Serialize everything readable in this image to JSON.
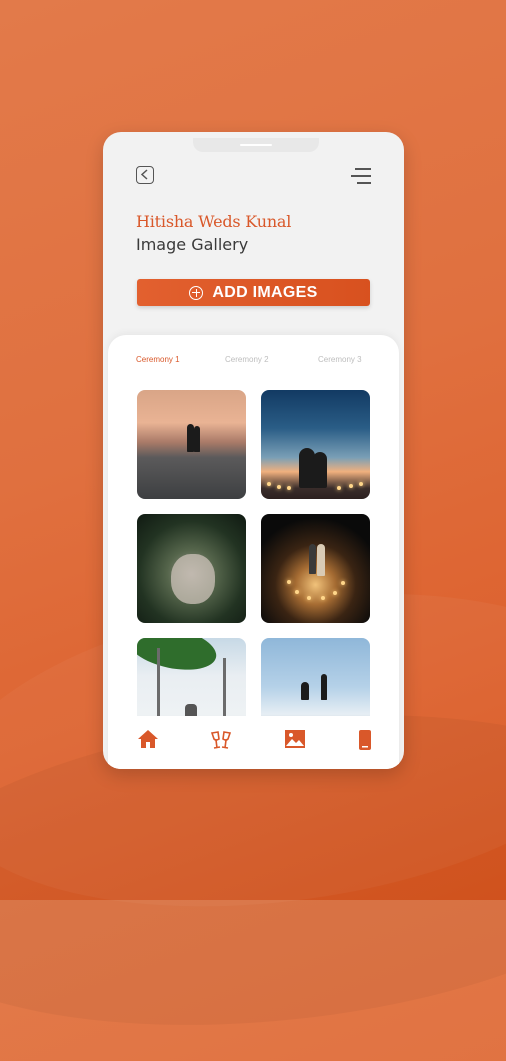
{
  "header": {
    "title_script": "Hitisha Weds Kunal",
    "title_main": "Image Gallery",
    "back_icon": "back-arrow-icon",
    "menu_icon": "hamburger-menu-icon"
  },
  "actions": {
    "add_images_label": "ADD IMAGES",
    "add_icon": "plus-circle-icon"
  },
  "tabs": [
    {
      "label": "Ceremony 1",
      "active": true
    },
    {
      "label": "Ceremony 2",
      "active": false
    },
    {
      "label": "Ceremony 3",
      "active": false
    }
  ],
  "bottom_nav": [
    {
      "icon": "home-icon"
    },
    {
      "icon": "cheers-glasses-icon"
    },
    {
      "icon": "image-gallery-icon"
    },
    {
      "icon": "mobile-phone-icon"
    }
  ],
  "colors": {
    "accent": "#d9582a",
    "background": "#e0703f",
    "tab_inactive": "#bdbdbd"
  }
}
